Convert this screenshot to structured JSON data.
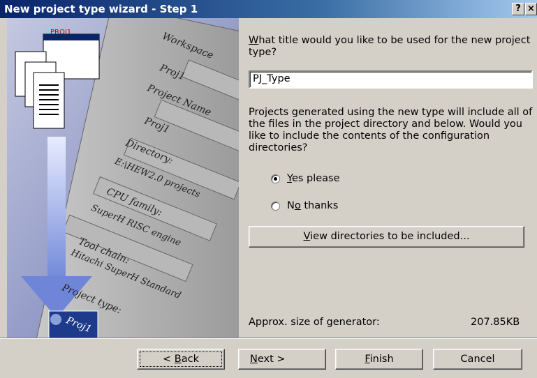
{
  "window": {
    "title": "New project type wizard - Step 1",
    "help_label": "?",
    "close_label": "×"
  },
  "art": {
    "doc_caption": "PROJ1",
    "fields": [
      {
        "label": "Workspace",
        "value": "Proj1"
      },
      {
        "label": "Project Name",
        "value": "Proj1"
      },
      {
        "label": "Directory:",
        "value": "E:\\HEW2.0 projects"
      },
      {
        "label": "CPU family:",
        "value": "SuperH RISC engine"
      },
      {
        "label": "Tool chain:",
        "value": "Hitachi SuperH Standard"
      },
      {
        "label": "Project type:",
        "value": "Proj1"
      }
    ]
  },
  "form": {
    "title_question_prefix": "W",
    "title_question_rest": "hat title would you like to be used for the new project type?",
    "title_value": "PJ_Type",
    "include_question": "Projects generated using the new type will include all of the files in the project directory and below. Would you like to include the contents of the configuration directories?",
    "yes_prefix": "Y",
    "yes_rest": "es please",
    "no_prefix": "N",
    "no_u": "o",
    "no_rest": " thanks",
    "selected": "yes",
    "view_prefix": "V",
    "view_rest": "iew directories to be included...",
    "size_label": "Approx. size of generator:",
    "size_value": "207.85KB"
  },
  "footer": {
    "back_prefix": "< ",
    "back_u": "B",
    "back_rest": "ack",
    "next_u": "N",
    "next_rest": "ext >",
    "finish_u": "F",
    "finish_rest": "inish",
    "cancel_label": "Cancel"
  }
}
